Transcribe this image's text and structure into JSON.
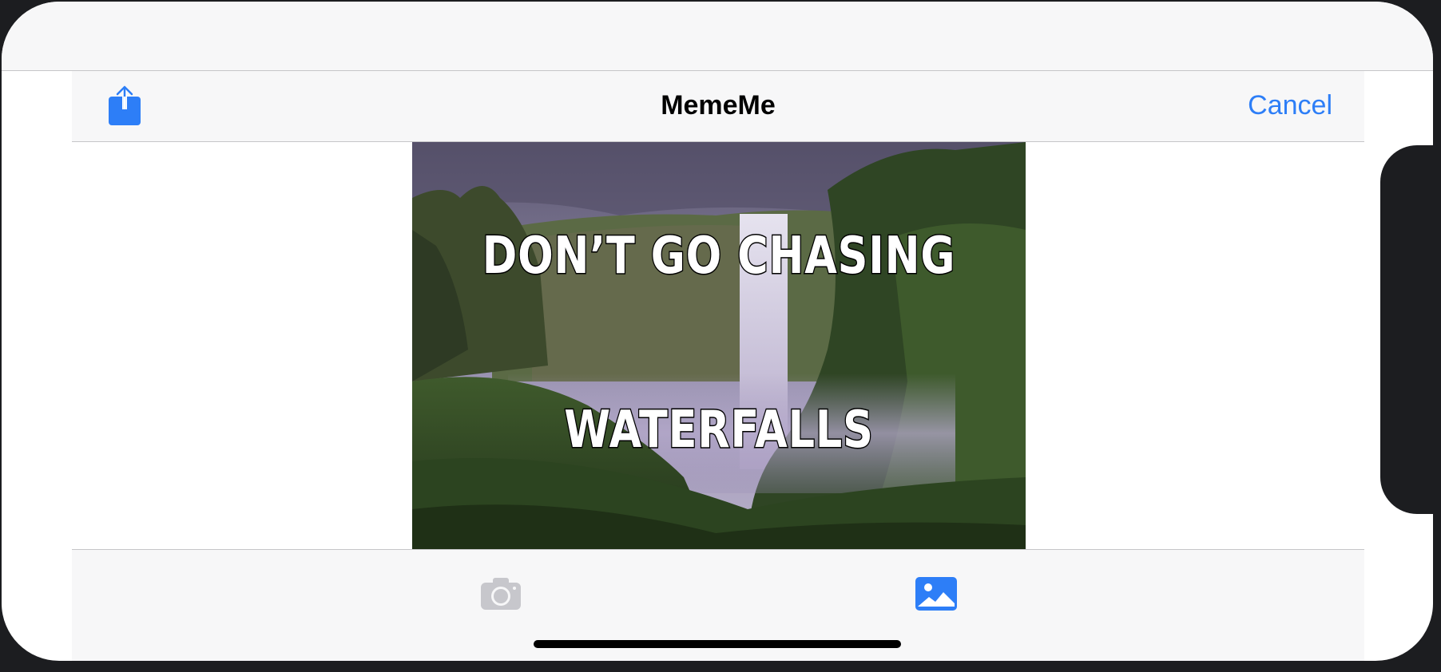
{
  "nav": {
    "title": "MemeMe",
    "cancel_label": "Cancel",
    "share_icon": "share-icon"
  },
  "meme": {
    "top_text": "DON’T GO CHASING",
    "bottom_text": "WATERFALLS",
    "image": "waterfall-landscape"
  },
  "toolbar": {
    "camera_icon": "camera-icon",
    "album_icon": "photo-album-icon"
  },
  "colors": {
    "accent": "#2d7ef7",
    "disabled": "#c7c7cc",
    "bar_background": "#f7f7f8"
  }
}
